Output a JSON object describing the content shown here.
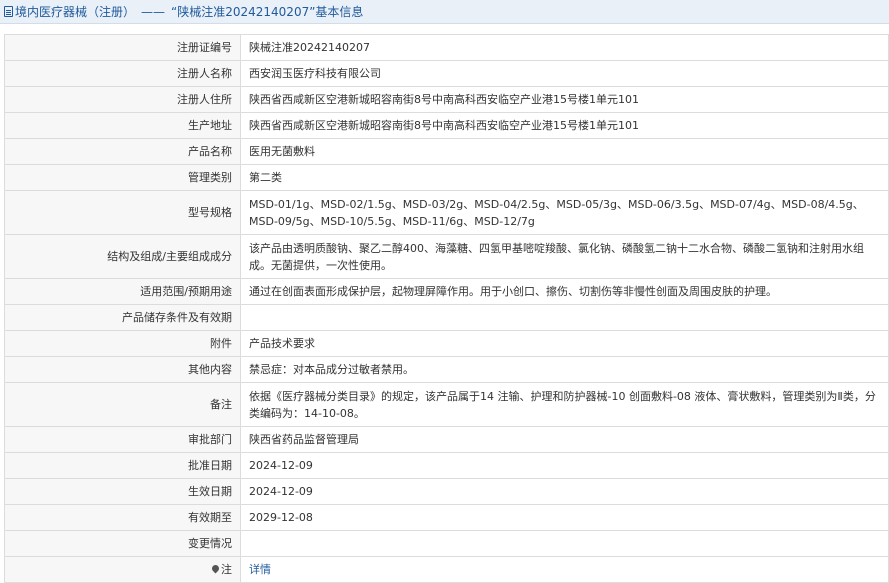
{
  "header": {
    "category": "境内医疗器械（注册）",
    "separator": "——",
    "record_title": "“陕械注准20242140207”基本信息"
  },
  "rows": [
    {
      "label": "注册证编号",
      "value": "陕械注准20242140207"
    },
    {
      "label": "注册人名称",
      "value": "西安润玉医疗科技有限公司"
    },
    {
      "label": "注册人住所",
      "value": "陕西省西咸新区空港新城昭容南街8号中南高科西安临空产业港15号楼1单元101"
    },
    {
      "label": "生产地址",
      "value": "陕西省西咸新区空港新城昭容南街8号中南高科西安临空产业港15号楼1单元101"
    },
    {
      "label": "产品名称",
      "value": "医用无菌敷料"
    },
    {
      "label": "管理类别",
      "value": "第二类"
    },
    {
      "label": "型号规格",
      "value": "MSD-01/1g、MSD-02/1.5g、MSD-03/2g、MSD-04/2.5g、MSD-05/3g、MSD-06/3.5g、MSD-07/4g、MSD-08/4.5g、MSD-09/5g、MSD-10/5.5g、MSD-11/6g、MSD-12/7g"
    },
    {
      "label": "结构及组成/主要组成成分",
      "value": "该产品由透明质酸钠、聚乙二醇400、海藻糖、四氢甲基嘧啶羧酸、氯化钠、磷酸氢二钠十二水合物、磷酸二氢钠和注射用水组成。无菌提供，一次性使用。"
    },
    {
      "label": "适用范围/预期用途",
      "value": "通过在创面表面形成保护层，起物理屏障作用。用于小创口、擦伤、切割伤等非慢性创面及周围皮肤的护理。"
    },
    {
      "label": "产品储存条件及有效期",
      "value": ""
    },
    {
      "label": "附件",
      "value": "产品技术要求"
    },
    {
      "label": "其他内容",
      "value": "禁忌症：对本品成分过敏者禁用。"
    },
    {
      "label": "备注",
      "value": "依据《医疗器械分类目录》的规定，该产品属于14 注输、护理和防护器械-10 创面敷料-08 液体、膏状敷料，管理类别为Ⅱ类，分类编码为：14-10-08。"
    },
    {
      "label": "审批部门",
      "value": "陕西省药品监督管理局"
    },
    {
      "label": "批准日期",
      "value": "2024-12-09"
    },
    {
      "label": "生效日期",
      "value": "2024-12-09"
    },
    {
      "label": "有效期至",
      "value": "2029-12-08"
    },
    {
      "label": "变更情况",
      "value": ""
    }
  ],
  "note_row": {
    "label": "注",
    "link": "详情",
    "icon": "pin-icon"
  }
}
